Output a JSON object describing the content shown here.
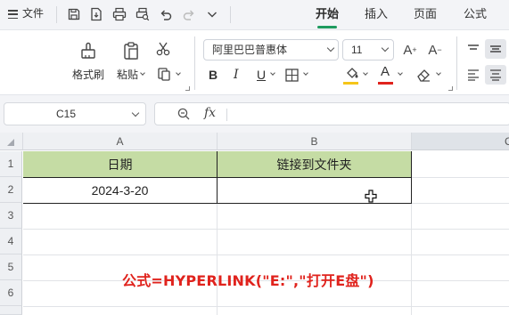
{
  "menu": {
    "file_label": "文件",
    "tabs": [
      {
        "label": "开始",
        "active": true
      },
      {
        "label": "插入",
        "active": false
      },
      {
        "label": "页面",
        "active": false
      },
      {
        "label": "公式",
        "active": false
      }
    ],
    "quick_icons": [
      "save-icon",
      "export-pdf-icon",
      "print-icon",
      "print-preview-icon",
      "undo-icon",
      "redo-icon",
      "more-chevron-icon"
    ]
  },
  "ribbon": {
    "format_painter_label": "格式刷",
    "paste_label": "粘贴",
    "font_name": "阿里巴巴普惠体",
    "font_size": "11",
    "bold": "B",
    "italic": "I",
    "underline": "U",
    "fill_color": "#f5c518",
    "font_color": "#e0231d"
  },
  "formula_bar": {
    "name_box": "C15",
    "fx": "fx",
    "content": ""
  },
  "sheet": {
    "columns": [
      "A",
      "B",
      "C"
    ],
    "rows": [
      "1",
      "2",
      "3",
      "4",
      "5",
      "6"
    ],
    "header_fill": "#c5dca4",
    "cells": {
      "A1": "日期",
      "B1": "链接到文件夹",
      "A2": "2024-3-20",
      "B2": ""
    }
  },
  "annotation": "公式=HYPERLINK(\"E:\",\"打开E盘\")"
}
